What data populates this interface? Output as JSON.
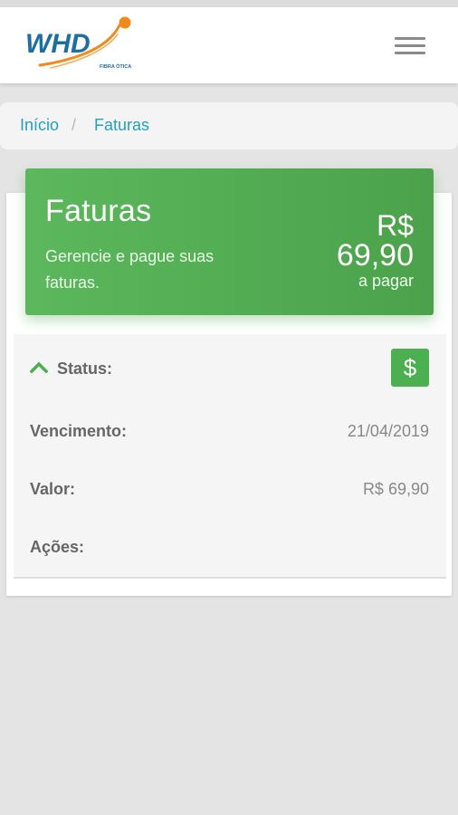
{
  "brand": {
    "logo_text": "WHD",
    "logo_tagline": "FIBRA ÓTICA",
    "accent": "#f08a1c",
    "primary": "#1d6fa3"
  },
  "header": {
    "menu_icon": "hamburger-menu-icon"
  },
  "breadcrumb": {
    "home": "Início",
    "separator": "/",
    "current": "Faturas",
    "link_color": "#24a0bf"
  },
  "banner": {
    "title": "Faturas",
    "subtitle": "Gerencie e pague suas faturas.",
    "currency": "R$",
    "amount": "69,90",
    "amount_caption": "a pagar",
    "color": "#5cb85c"
  },
  "invoice": {
    "status_label": "Status:",
    "status_icon": "dollar-icon",
    "due_label": "Vencimento:",
    "due_value": "21/04/2019",
    "value_label": "Valor:",
    "value_value": "R$ 69,90",
    "actions_label": "Ações:"
  }
}
